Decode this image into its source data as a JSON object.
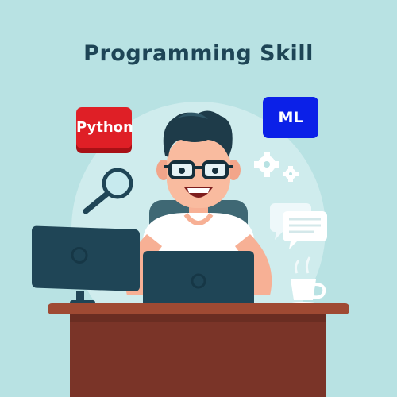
{
  "title": "Programming Skill",
  "tags": {
    "python": "Python",
    "ml": "ML"
  },
  "icons": {
    "search": "magnifier-icon",
    "gears": "gears-icon",
    "chat": "chat-bubbles-icon",
    "cup": "coffee-cup-icon"
  },
  "colors": {
    "background": "#b8e2e3",
    "title": "#1e4556",
    "python_tag": "#df1f26",
    "ml_tag": "#0b20e8",
    "desk": "#7a3428",
    "monitor": "#1f4556"
  }
}
